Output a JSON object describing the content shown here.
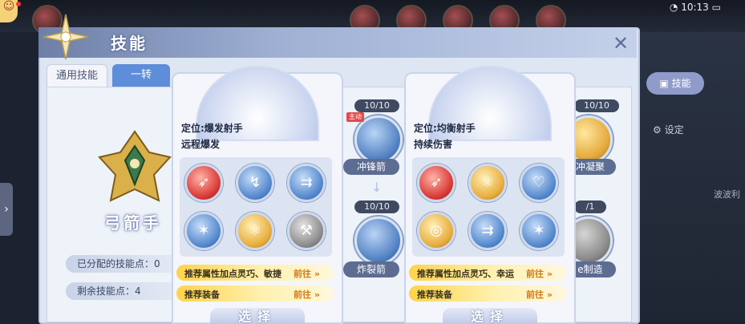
{
  "status_bar": {
    "time": "10:13"
  },
  "dialog": {
    "title": "技能",
    "tabs": [
      {
        "label": "通用技能",
        "active": false
      },
      {
        "label": "一转",
        "active": true
      }
    ]
  },
  "class_panel": {
    "class_name": "弓箭手",
    "stats": [
      {
        "label": "已分配的技能点：0"
      },
      {
        "label": "剩余技能点：4"
      }
    ]
  },
  "background_skills": [
    {
      "level": "10/10",
      "name": "冲锋箭",
      "active_tag": "主动"
    },
    {
      "level": "10/10",
      "name": "炸裂箭"
    },
    {
      "level": "10/10",
      "name": "冲凝聚"
    },
    {
      "level": "/1",
      "name": "e制造"
    }
  ],
  "side_menu": {
    "skill_button": "技能",
    "settings": "设定",
    "right_text": "波波利"
  },
  "cards": [
    {
      "position": "定位:爆发射手",
      "subtitle": "远程爆发",
      "icons": [
        "red",
        "blue",
        "blue",
        "blue",
        "gold",
        "gray"
      ],
      "recommend_attr": "推荐属性加点灵巧、敏捷",
      "recommend_gear": "推荐装备",
      "go_label": "前往",
      "select_label": "选择"
    },
    {
      "position": "定位:均衡射手",
      "subtitle": "持续伤害",
      "icons": [
        "red",
        "gold",
        "blue",
        "gold",
        "blue",
        "blue"
      ],
      "recommend_attr": "推荐属性加点灵巧、幸运",
      "recommend_gear": "推荐装备",
      "go_label": "前往",
      "select_label": "选择"
    }
  ],
  "colors": {
    "tab_active": "#5e8ed9",
    "recommend_bar": "#ffd34a",
    "go_text": "#d07a16",
    "active_tag": "#e44a4a"
  }
}
